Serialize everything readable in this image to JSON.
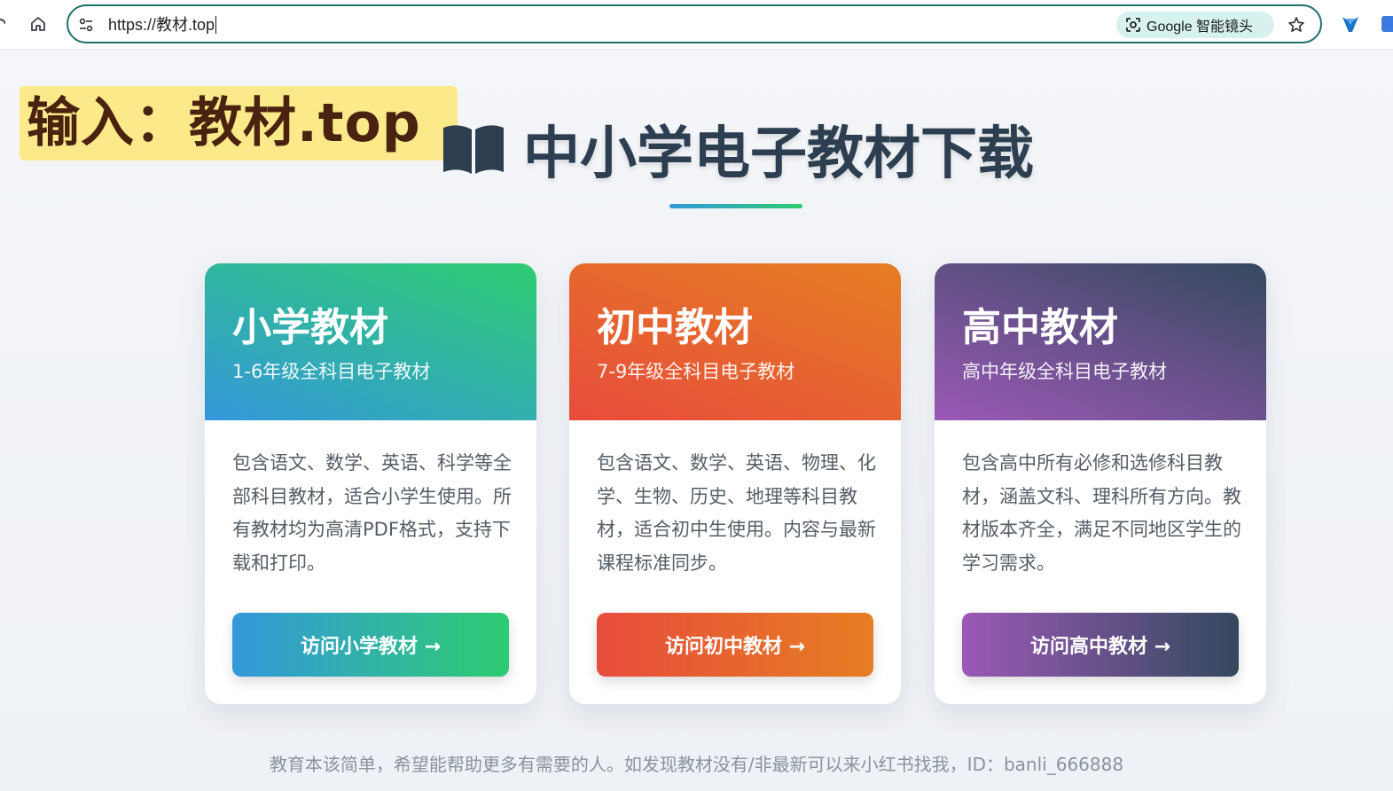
{
  "browser": {
    "url": "https://教材.top",
    "lens_label": "Google 智能镜头"
  },
  "overlay": {
    "text": "输入：教材.top"
  },
  "page": {
    "title": "中小学电子教材下载",
    "footer": "教育本该简单，希望能帮助更多有需要的人。如发现教材没有/非最新可以来小红书找我，ID：banli_666888"
  },
  "cards": [
    {
      "title": "小学教材",
      "subtitle": "1-6年级全科目电子教材",
      "description": "包含语文、数学、英语、科学等全部科目教材，适合小学生使用。所有教材均为高清PDF格式，支持下载和打印。",
      "button": "访问小学教材 →"
    },
    {
      "title": "初中教材",
      "subtitle": "7-9年级全科目电子教材",
      "description": "包含语文、数学、英语、物理、化学、生物、历史、地理等科目教材，适合初中生使用。内容与最新课程标准同步。",
      "button": "访问初中教材 →"
    },
    {
      "title": "高中教材",
      "subtitle": "高中年级全科目电子教材",
      "description": "包含高中所有必修和选修科目教材，涵盖文科、理科所有方向。教材版本齐全，满足不同地区学生的学习需求。",
      "button": "访问高中教材 →"
    }
  ],
  "colors": {
    "accent_omnibox": "#1f6f6b",
    "title_text": "#2c3e50",
    "elementary_gradient": [
      "#3498db",
      "#2ecc71"
    ],
    "middle_gradient": [
      "#e74c3c",
      "#e67e22"
    ],
    "high_gradient": [
      "#9b59b6",
      "#34495e"
    ]
  },
  "icons": {
    "home": "home-icon",
    "site_info": "tune-icon",
    "lens": "google-lens-icon",
    "bookmark": "star-icon",
    "extension": "extension-icon",
    "book": "book-icon"
  }
}
